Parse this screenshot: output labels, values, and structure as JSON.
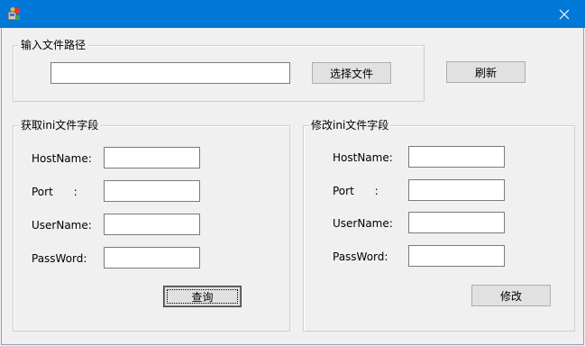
{
  "window": {
    "title": "",
    "icon": "app-icon",
    "close_icon": "close-icon",
    "title_bar_color": "#0078d7"
  },
  "file_path_group": {
    "title": "输入文件路径",
    "path_value": "",
    "choose_file_label": "选择文件"
  },
  "refresh_label": "刷新",
  "read_group": {
    "title": "获取ini文件字段",
    "fields": [
      {
        "label": "HostName:",
        "value": ""
      },
      {
        "label": "Port      :",
        "value": ""
      },
      {
        "label": "UserName:",
        "value": ""
      },
      {
        "label": "PassWord:",
        "value": ""
      }
    ],
    "query_label": "查询"
  },
  "modify_group": {
    "title": "修改ini文件字段",
    "fields": [
      {
        "label": "HostName:",
        "value": ""
      },
      {
        "label": "Port      :",
        "value": ""
      },
      {
        "label": "UserName:",
        "value": ""
      },
      {
        "label": "PassWord:",
        "value": ""
      }
    ],
    "modify_label": "修改"
  }
}
